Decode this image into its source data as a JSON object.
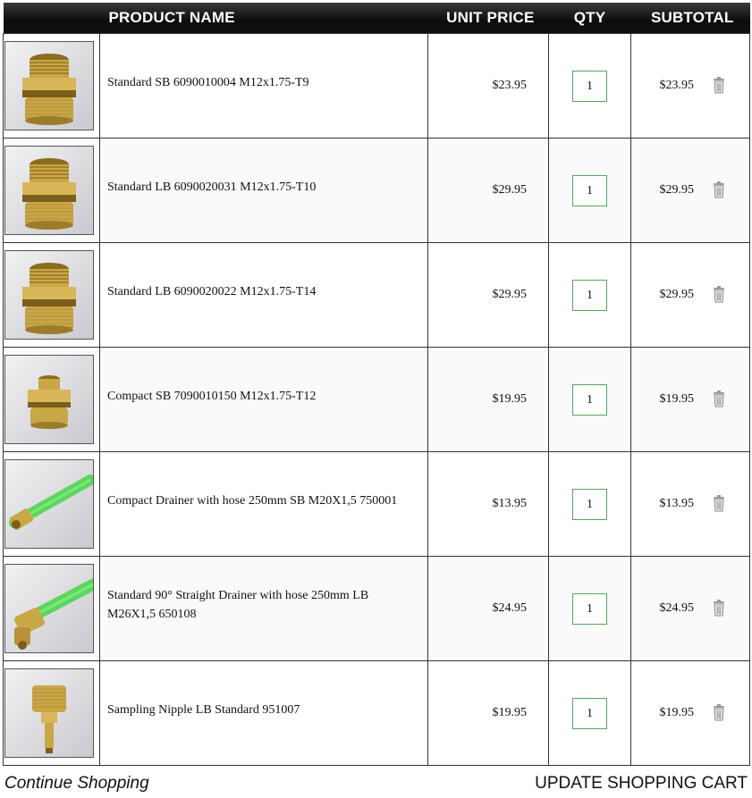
{
  "header": {
    "product_name": "PRODUCT NAME",
    "unit_price": "UNIT PRICE",
    "qty": "QTY",
    "subtotal": "SUBTOTAL"
  },
  "items": [
    {
      "name": "Standard SB 6090010004 M12x1.75-T9",
      "price": "$23.95",
      "qty": "1",
      "subtotal": "$23.95",
      "image": "brass-fitting-tall-icon"
    },
    {
      "name": "Standard LB 6090020031 M12x1.75-T10",
      "price": "$29.95",
      "qty": "1",
      "subtotal": "$29.95",
      "image": "brass-fitting-tall-icon"
    },
    {
      "name": "Standard LB 6090020022 M12x1.75-T14",
      "price": "$29.95",
      "qty": "1",
      "subtotal": "$29.95",
      "image": "brass-fitting-tall-icon"
    },
    {
      "name": "Compact SB 7090010150 M12x1.75-T12",
      "price": "$19.95",
      "qty": "1",
      "subtotal": "$19.95",
      "image": "brass-fitting-compact-icon"
    },
    {
      "name": "Compact Drainer with hose 250mm SB M20X1,5 750001",
      "price": "$13.95",
      "qty": "1",
      "subtotal": "$13.95",
      "image": "green-hose-drainer-icon"
    },
    {
      "name": "Standard 90° Straight Drainer with hose 250mm LB M26X1,5 650108",
      "price": "$24.95",
      "qty": "1",
      "subtotal": "$24.95",
      "image": "green-hose-elbow-icon"
    },
    {
      "name": "Sampling Nipple LB Standard 951007",
      "price": "$19.95",
      "qty": "1",
      "subtotal": "$19.95",
      "image": "brass-nipple-icon"
    }
  ],
  "footer": {
    "continue": "Continue Shopping",
    "update": "UPDATE SHOPPING CART"
  },
  "colors": {
    "header_bg": "#111111",
    "qty_border": "#59a45d",
    "brass": "#c9a646",
    "hose": "#5cd65c"
  }
}
